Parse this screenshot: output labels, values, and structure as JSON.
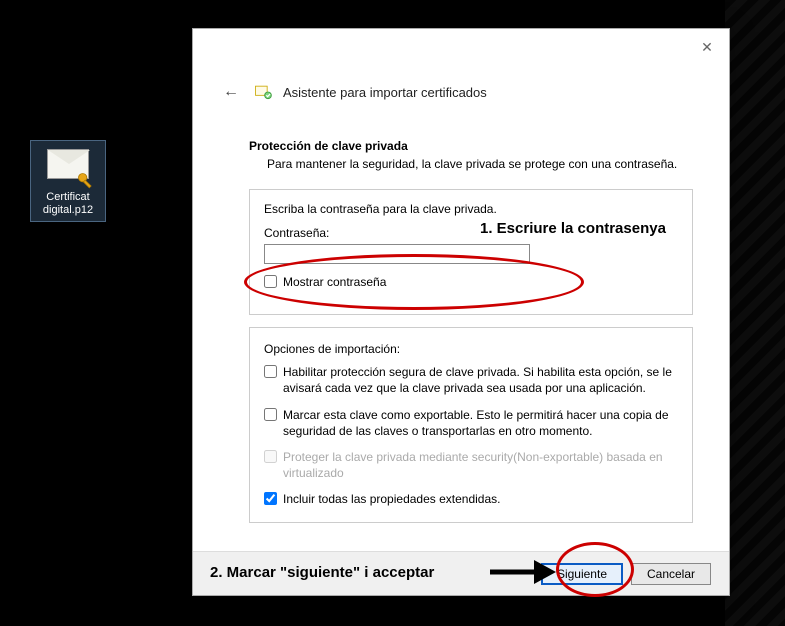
{
  "desktop": {
    "file_name": "Certificat digital.p12"
  },
  "wizard": {
    "title": "Asistente para importar certificados",
    "section": {
      "heading": "Protección de clave privada",
      "subheading": "Para mantener la seguridad, la clave privada se protege con una contraseña."
    },
    "password_group": {
      "instruction": "Escriba la contraseña para la clave privada.",
      "label": "Contraseña:",
      "value": "",
      "show_label": "Mostrar contraseña"
    },
    "import_options": {
      "group_label": "Opciones de importación:",
      "opt_strong": "Habilitar protección segura de clave privada. Si habilita esta opción, se le avisará cada vez que la clave privada sea usada por una aplicación.",
      "opt_exportable": "Marcar esta clave como exportable. Esto le permitirá hacer una copia de seguridad de las claves o transportarlas en otro momento.",
      "opt_protect_virtual": "Proteger la clave privada mediante security(Non-exportable) basada en virtualizado",
      "opt_extended": "Incluir todas las propiedades extendidas."
    },
    "buttons": {
      "next": "Siguiente",
      "cancel": "Cancelar"
    }
  },
  "annotations": {
    "step1": "1. Escriure la contrasenya",
    "step2": "2. Marcar \"siguiente\" i acceptar"
  }
}
